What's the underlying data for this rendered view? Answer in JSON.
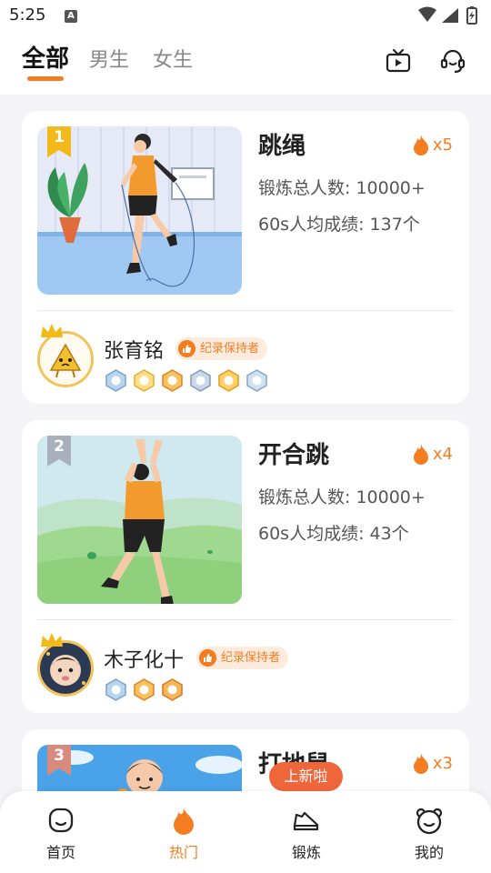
{
  "status_bar": {
    "time": "5:25",
    "notification_icon": "A"
  },
  "tabs": [
    {
      "label": "全部",
      "active": true
    },
    {
      "label": "男生",
      "active": false
    },
    {
      "label": "女生",
      "active": false
    }
  ],
  "header_icons": [
    "tv-icon",
    "headset-icon"
  ],
  "items": [
    {
      "rank": "1",
      "title": "跳绳",
      "hot": "x5",
      "total": "锻炼总人数: 10000+",
      "avg": "60s人均成绩: 137个",
      "user": "张育铭",
      "badge": "纪录保持者",
      "medal_count": 6
    },
    {
      "rank": "2",
      "title": "开合跳",
      "hot": "x4",
      "total": "锻炼总人数: 10000+",
      "avg": "60s人均成绩: 43个",
      "user": "木子化十",
      "badge": "纪录保持者",
      "medal_count": 3
    },
    {
      "rank": "3",
      "title": "打地鼠",
      "hot": "x3"
    }
  ],
  "new_bubble": "上新啦",
  "bottom_nav": [
    {
      "label": "首页",
      "icon": "home-face-icon",
      "active": false
    },
    {
      "label": "热门",
      "icon": "flame-icon",
      "active": true
    },
    {
      "label": "锻炼",
      "icon": "sneaker-icon",
      "active": false
    },
    {
      "label": "我的",
      "icon": "bear-face-icon",
      "active": false
    }
  ],
  "colors": {
    "accent": "#f47d22",
    "bubble": "#f0663b",
    "gold": "#f3c35a",
    "silver": "#a7b0bb",
    "bronze": "#d98a7f"
  }
}
